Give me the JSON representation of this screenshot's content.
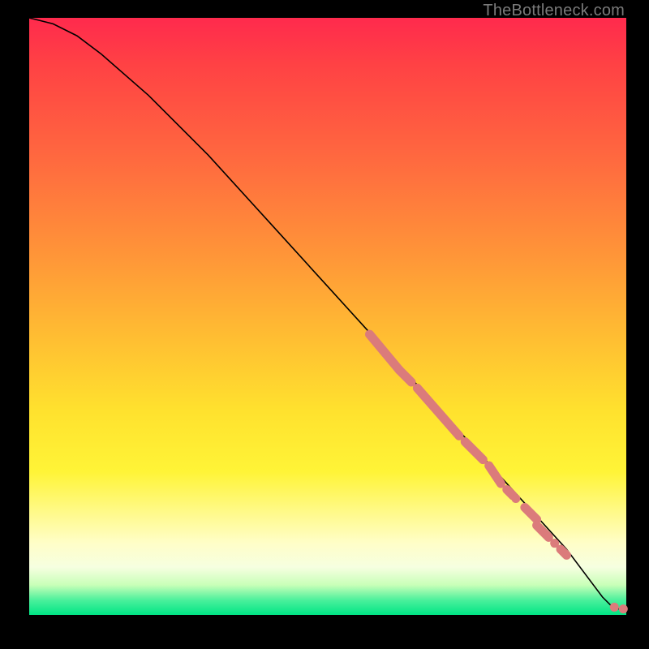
{
  "attribution": "TheBottleneck.com",
  "chart_data": {
    "type": "line",
    "title": "",
    "xlabel": "",
    "ylabel": "",
    "xlim": [
      0,
      100
    ],
    "ylim": [
      0,
      100
    ],
    "grid": false,
    "legend": false,
    "series": [
      {
        "name": "bottleneck-curve",
        "kind": "line",
        "x": [
          0,
          4,
          8,
          12,
          20,
          30,
          40,
          50,
          60,
          70,
          80,
          90,
          96,
          98,
          100
        ],
        "y": [
          100,
          99,
          97,
          94,
          87,
          77,
          66,
          55,
          44,
          33,
          22,
          11,
          3,
          1,
          1
        ]
      },
      {
        "name": "highlight-segments",
        "kind": "thick-overlay",
        "segments": [
          {
            "x0": 57,
            "y0": 47,
            "x1": 62,
            "y1": 41
          },
          {
            "x0": 62,
            "y0": 41,
            "x1": 64,
            "y1": 39
          },
          {
            "x0": 65,
            "y0": 38,
            "x1": 72,
            "y1": 30
          },
          {
            "x0": 73,
            "y0": 29,
            "x1": 76,
            "y1": 26
          },
          {
            "x0": 77,
            "y0": 25,
            "x1": 79,
            "y1": 22
          },
          {
            "x0": 80,
            "y0": 21,
            "x1": 81,
            "y1": 20
          },
          {
            "x0": 83,
            "y0": 18,
            "x1": 85,
            "y1": 16
          },
          {
            "x0": 85,
            "y0": 15,
            "x1": 87,
            "y1": 13
          },
          {
            "x0": 89,
            "y0": 11,
            "x1": 90,
            "y1": 10
          }
        ]
      },
      {
        "name": "highlight-dots",
        "kind": "scatter",
        "points": [
          {
            "x": 81.5,
            "y": 19.5
          },
          {
            "x": 88.0,
            "y": 12.0
          },
          {
            "x": 98.0,
            "y": 1.3
          },
          {
            "x": 99.5,
            "y": 1.0
          }
        ]
      }
    ]
  }
}
